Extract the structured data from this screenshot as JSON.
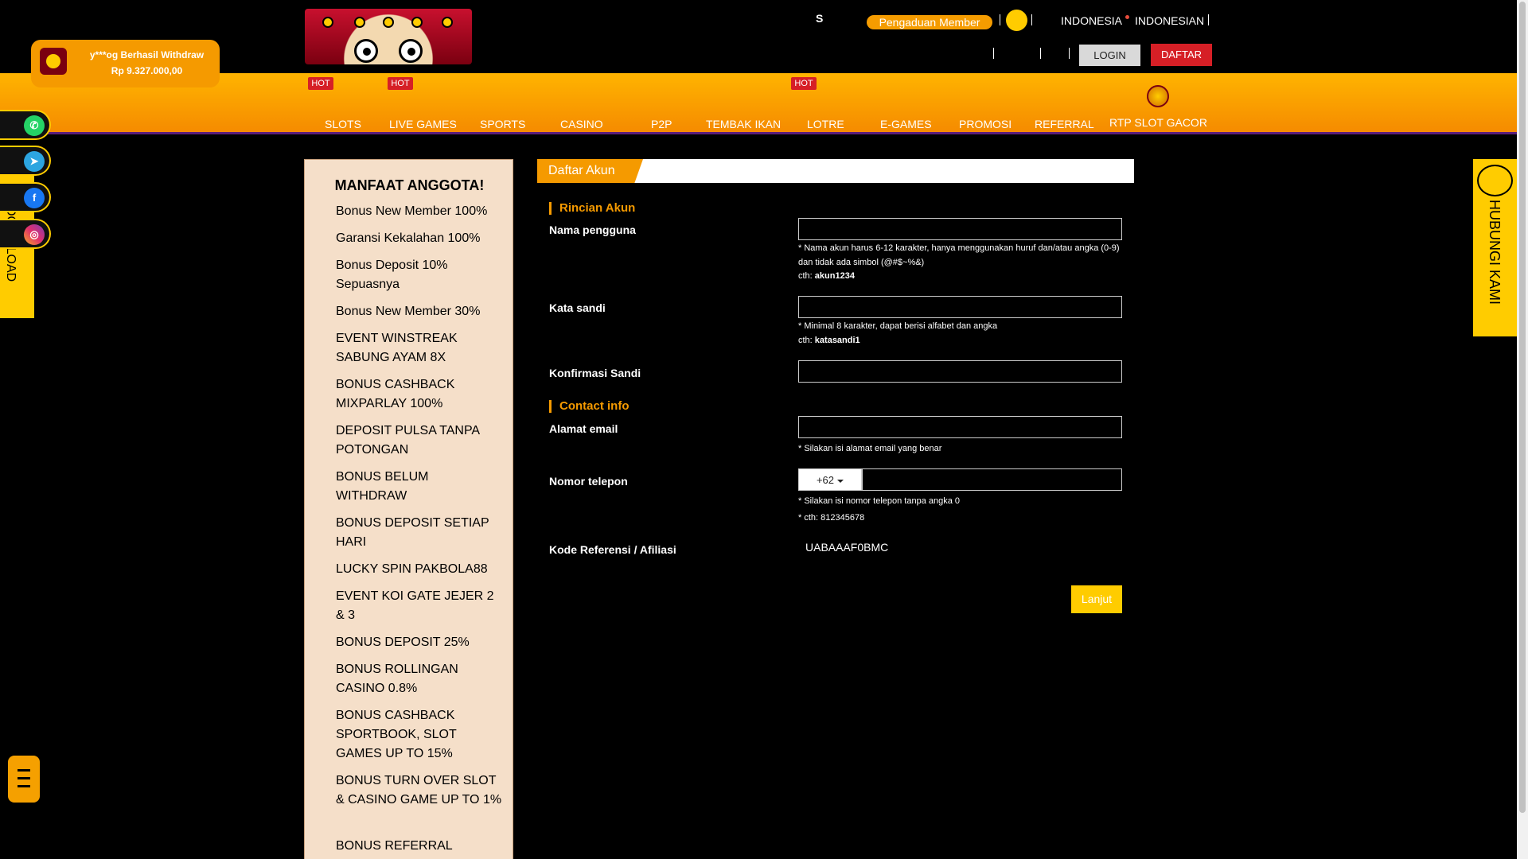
{
  "header": {
    "top_letter": "S",
    "complaint_label": "Pengaduan Member",
    "lang_country": "INDONESIA",
    "lang_language": "INDONESIAN",
    "login_label": "LOGIN",
    "register_label": "DAFTAR"
  },
  "withdraw_notice": {
    "line1": "y***og Berhasil Withdraw",
    "line2": "Rp 9.327.000,00"
  },
  "nav": {
    "hot_badge": "HOT",
    "items": [
      "SLOTS",
      "LIVE GAMES",
      "SPORTS",
      "CASINO",
      "P2P",
      "TEMBAK IKAN",
      "LOTRE",
      "E-GAMES",
      "PROMOSI",
      "REFERRAL",
      "RTP SLOT GACOR"
    ]
  },
  "sidebar_left": {
    "download_label": "DOWNLOAD",
    "social_icons": [
      "whatsapp-icon",
      "telegram-icon",
      "facebook-icon",
      "instagram-icon"
    ]
  },
  "sidebar_right": {
    "contact_label": "HUBUNGI KAMI"
  },
  "benefits": {
    "title": "MANFAAT ANGGOTA!",
    "items": [
      "Bonus New Member 100%",
      "Garansi Kekalahan 100%",
      "Bonus Deposit 10% Sepuasnya",
      "Bonus New Member 30%",
      "EVENT WINSTREAK SABUNG AYAM 8X",
      "BONUS CASHBACK MIXPARLAY 100%",
      "DEPOSIT PULSA TANPA POTONGAN",
      "BONUS BELUM WITHDRAW",
      "BONUS DEPOSIT SETIAP HARI",
      "LUCKY SPIN PAKBOLA88",
      "EVENT KOI GATE JEJER 2 & 3",
      "BONUS DEPOSIT 25%",
      "BONUS ROLLINGAN CASINO 0.8%",
      "BONUS CASHBACK SPORTBOOK, SLOT GAMES UP TO 15%",
      "BONUS TURN OVER SLOT & CASINO GAME UP TO 1%",
      "BONUS REFERRAL"
    ]
  },
  "form": {
    "tab_title": "Daftar Akun",
    "section_account": "Rincian Akun",
    "section_contact": "Contact info",
    "username_label": "Nama pengguna",
    "username_value": "",
    "username_hint": "* Nama akun harus 6-12 karakter, hanya menggunakan huruf dan/atau angka (0-9) dan tidak ada simbol (@#$~%&)",
    "example_prefix": "cth:",
    "username_example": "akun1234",
    "password_label": "Kata sandi",
    "password_value": "",
    "password_hint": "* Minimal 8 karakter, dapat berisi alfabet dan angka",
    "password_example": "katasandi1",
    "confirm_label": "Konfirmasi Sandi",
    "confirm_value": "",
    "email_label": "Alamat email",
    "email_value": "",
    "email_hint": "* Silakan isi alamat email yang benar",
    "phone_label": "Nomor telepon",
    "phone_prefix": "+62",
    "phone_value": "",
    "phone_hint1": "* Silakan isi nomor telepon tanpa angka 0",
    "phone_hint2": "* cth: 812345678",
    "referral_label": "Kode Referensi / Afiliasi",
    "referral_value": "UABAAAF0BMC",
    "submit_label": "Lanjut"
  }
}
